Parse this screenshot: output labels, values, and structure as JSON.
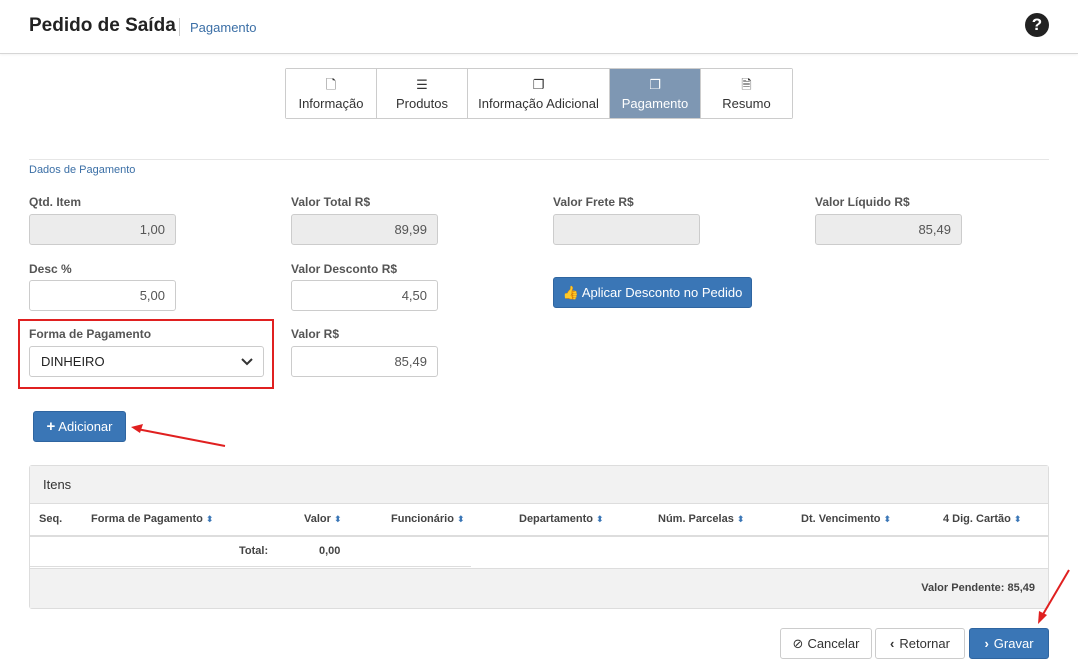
{
  "header": {
    "title": "Pedido de Saída",
    "subtitle": "Pagamento",
    "help_icon": "question-circle-icon"
  },
  "wizard": {
    "steps": [
      {
        "label": "Informação",
        "icon": "file-icon",
        "active": false
      },
      {
        "label": "Produtos",
        "icon": "list-icon",
        "active": false
      },
      {
        "label": "Informação Adicional",
        "icon": "copy-icon",
        "active": false
      },
      {
        "label": "Pagamento",
        "icon": "copy-icon",
        "active": true
      },
      {
        "label": "Resumo",
        "icon": "file-text-icon",
        "active": false
      }
    ]
  },
  "section": {
    "title": "Dados de Pagamento"
  },
  "form": {
    "qtd_item": {
      "label": "Qtd. Item",
      "value": "1,00"
    },
    "valor_total": {
      "label": "Valor Total R$",
      "value": "89,99"
    },
    "valor_frete": {
      "label": "Valor Frete R$",
      "value": ""
    },
    "valor_liquido": {
      "label": "Valor Líquido R$",
      "value": "85,49"
    },
    "desc_pct": {
      "label": "Desc %",
      "value": "5,00"
    },
    "valor_desconto": {
      "label": "Valor Desconto R$",
      "value": "4,50"
    },
    "aplicar_desconto": {
      "label": "Aplicar Desconto no Pedido"
    },
    "forma_pagamento": {
      "label": "Forma de Pagamento",
      "value": "DINHEIRO"
    },
    "valor": {
      "label": "Valor R$",
      "value": "85,49"
    }
  },
  "adicionar": {
    "label": "Adicionar"
  },
  "itens": {
    "title": "Itens",
    "columns": [
      "Seq.",
      "Forma de Pagamento",
      "Valor",
      "Funcionário",
      "Departamento",
      "Núm. Parcelas",
      "Dt. Vencimento",
      "4 Dig. Cartão"
    ],
    "total_label": "Total:",
    "total_value": "0,00",
    "pendente": "Valor Pendente: 85,49"
  },
  "actions": {
    "cancelar": "Cancelar",
    "retornar": "Retornar",
    "gravar": "Gravar"
  },
  "colors": {
    "primary": "#3a76b6",
    "active_step": "#7e97b3",
    "highlight": "#e02020"
  }
}
